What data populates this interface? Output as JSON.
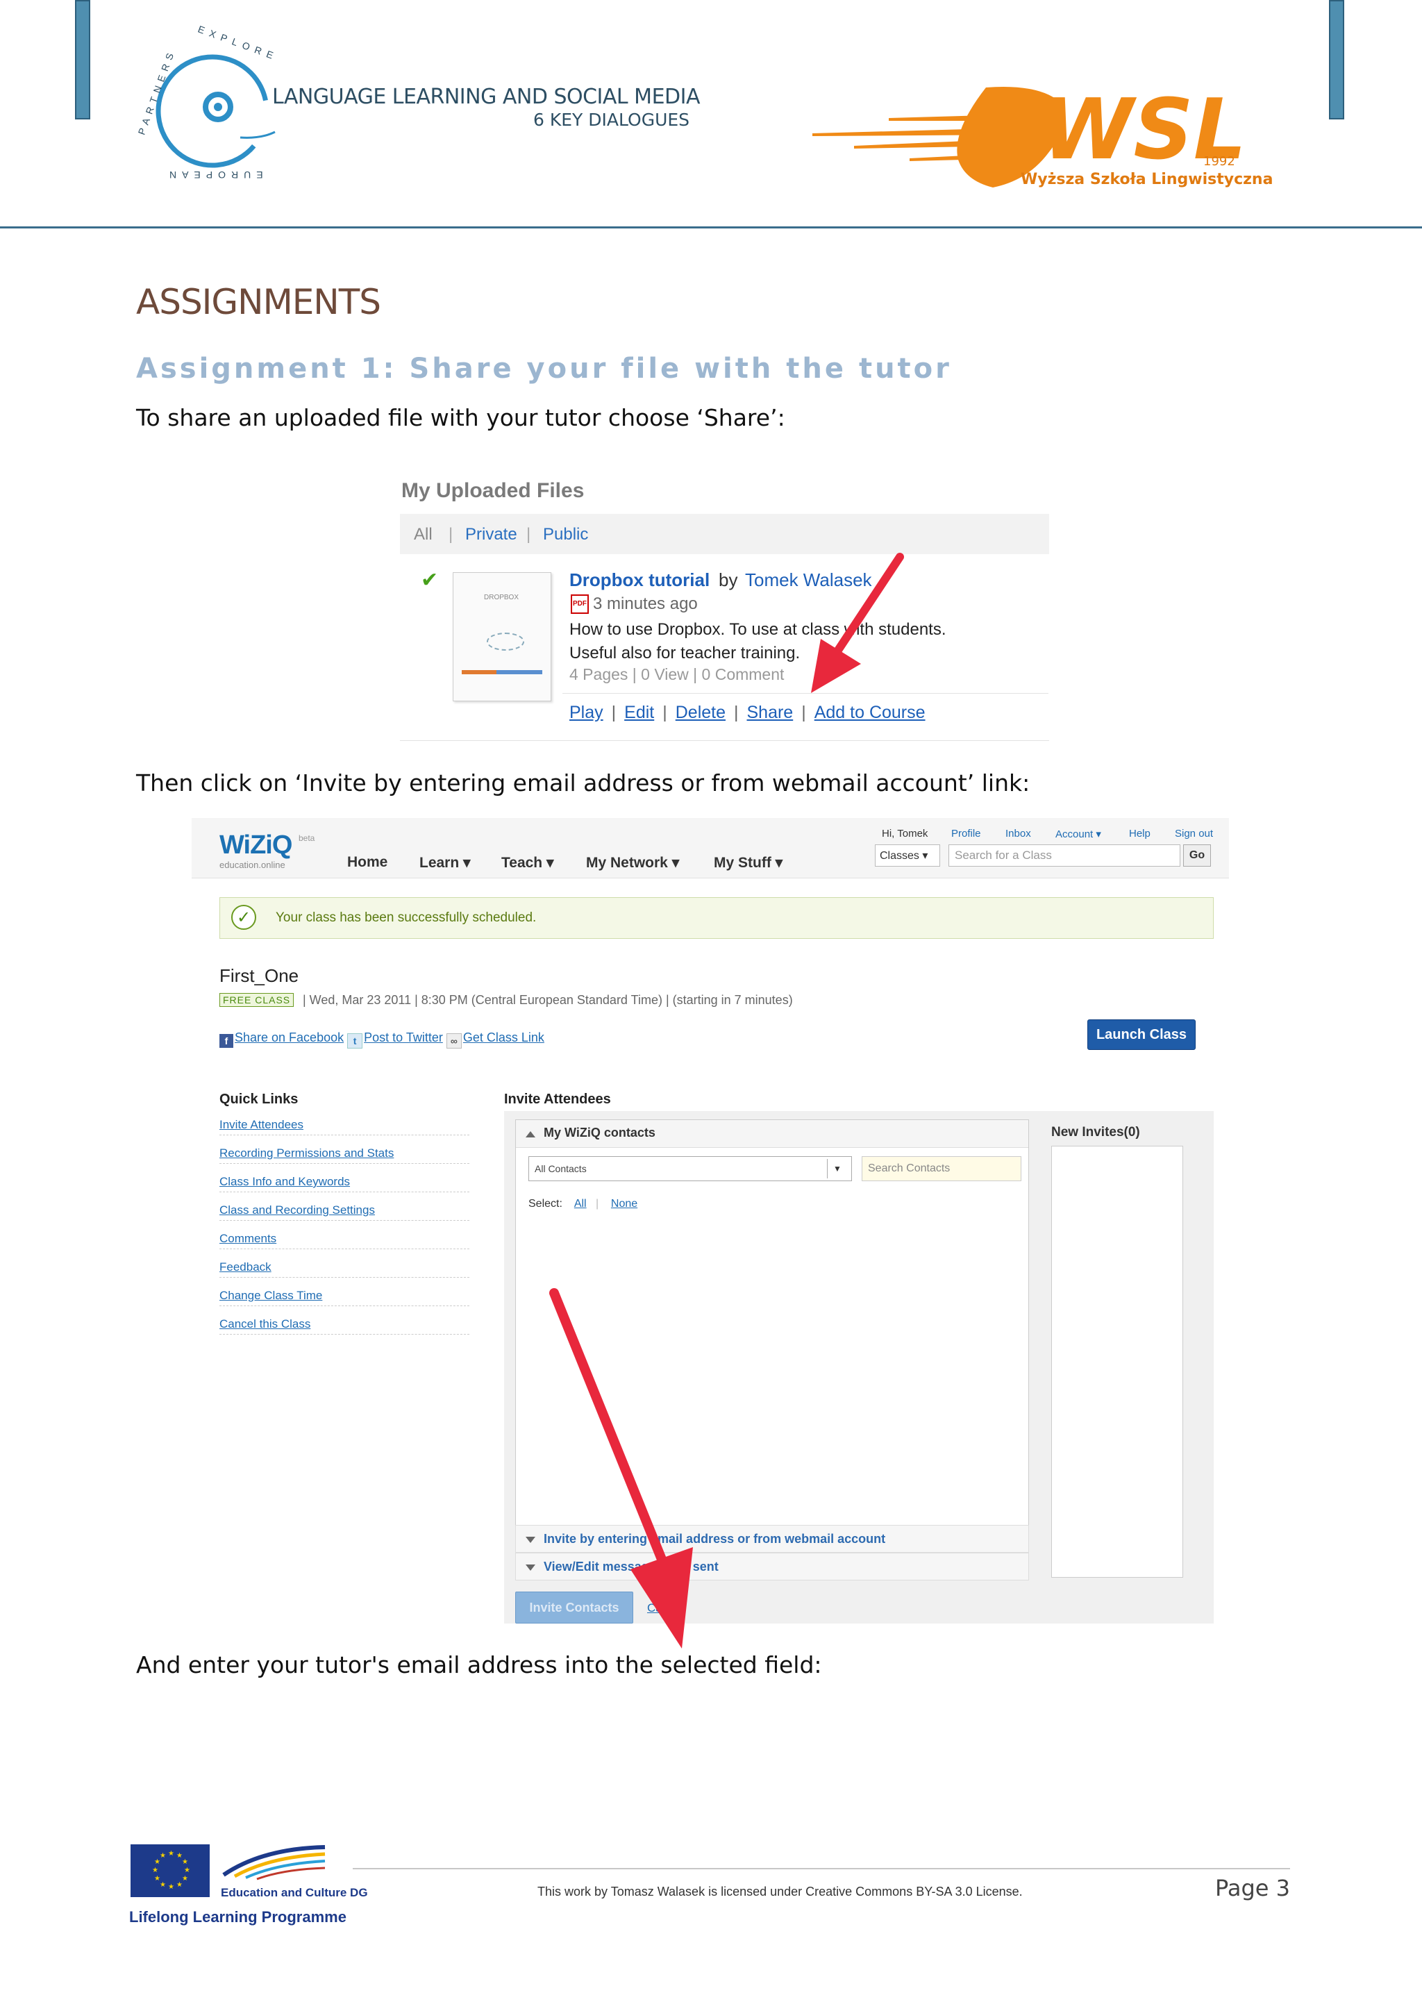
{
  "header": {
    "left_logo": {
      "ring_text_top": "EXPLORE",
      "ring_text_left": "PARTNERS",
      "ring_text_bottom": "EUROPEAN",
      "title": "LANGUAGE LEARNING AND SOCIAL MEDIA",
      "subtitle": "6 KEY DIALOGUES"
    },
    "right_logo": {
      "mark": "WSL",
      "year": "1992",
      "name": "Wyższa Szkoła Lingwistyczna"
    }
  },
  "doc": {
    "heading": "ASSIGNMENTS",
    "subheading": "Assignment 1: Share your file with the tutor",
    "para1": "To share an uploaded file with your tutor choose ‘Share’:",
    "para2": "Then click on ‘Invite by entering email address or from webmail account’ link:",
    "para3": "And enter your tutor's email address into the selected field:"
  },
  "screenshot1": {
    "title": "My Uploaded Files",
    "tabs": [
      "All",
      "Private",
      "Public"
    ],
    "thumb_label": "DROPBOX",
    "file_title": "Dropbox tutorial",
    "by": "by",
    "author": "Tomek Walasek",
    "time_ago": "3 minutes ago",
    "desc_line1": "How to use Dropbox. To use at class with students.",
    "desc_line2": "Useful also for teacher training.",
    "meta": "4 Pages   |   0 View   |   0 Comment",
    "actions": [
      "Play",
      "Edit",
      "Delete",
      "Share",
      "Add to Course"
    ]
  },
  "screenshot2": {
    "logo": "WiZiQ",
    "logo_beta": "beta",
    "logo_tag": "education.online",
    "nav": [
      "Home",
      "Learn ▾",
      "Teach ▾",
      "My Network ▾",
      "My Stuff ▾"
    ],
    "toplinks": [
      "Hi, Tomek",
      "Profile",
      "Inbox",
      "Account ▾",
      "Help",
      "Sign out"
    ],
    "classes_dropdown": "Classes ▾",
    "search_placeholder": "Search for a Class",
    "go": "Go",
    "success": "Your class has been successfully scheduled.",
    "class_title": "First_One",
    "free_badge": "FREE CLASS",
    "class_meta": "|   Wed, Mar 23 2011   |   8:30 PM (Central European Standard Time)   |   (starting in 7 minutes)",
    "share_facebook": "Share on Facebook",
    "share_twitter": "Post to Twitter",
    "get_link": "Get Class Link",
    "launch": "Launch Class",
    "quick_links_title": "Quick Links",
    "quick_links": [
      "Invite Attendees",
      "Recording Permissions and Stats",
      "Class Info and Keywords",
      "Class and Recording Settings",
      "Comments",
      "Feedback",
      "Change Class Time",
      "Cancel this Class"
    ],
    "invite_title": "Invite Attendees",
    "contacts_title": "My WiZiQ contacts",
    "all_contacts": "All Contacts",
    "search_contacts": "Search Contacts",
    "select_label": "Select:",
    "select_all": "All",
    "select_none": "None",
    "invite_email": "Invite by entering email address or from webmail account",
    "view_edit": "View/Edit message to be sent",
    "new_invites": "New Invites(0)",
    "invite_button": "Invite Contacts",
    "cancel": "Cancel"
  },
  "footer": {
    "dg": "Education and Culture DG",
    "programme": "Lifelong Learning Programme",
    "license": "This work by Tomasz Walasek is licensed under Creative Commons BY-SA 3.0 License.",
    "page": "Page 3"
  }
}
